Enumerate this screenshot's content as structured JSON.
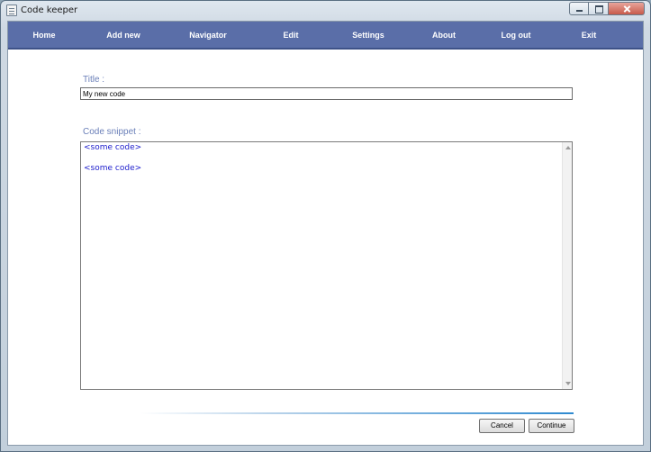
{
  "window": {
    "title": "Code keeper",
    "controls": [
      "minimize-icon",
      "maximize-icon",
      "close-icon"
    ]
  },
  "menu": {
    "items": [
      {
        "label": "Home"
      },
      {
        "label": "Add new"
      },
      {
        "label": "Navigator"
      },
      {
        "label": "Edit"
      },
      {
        "label": "Settings"
      },
      {
        "label": "About"
      },
      {
        "label": "Log out"
      },
      {
        "label": "Exit"
      }
    ]
  },
  "form": {
    "title_label": "Title :",
    "title_value": "My new code",
    "snippet_label": "Code snippet :",
    "snippet_lines": [
      "<some code>",
      "",
      "<some code>"
    ]
  },
  "buttons": {
    "cancel": "Cancel",
    "continue": "Continue"
  },
  "colors": {
    "menubar": "#5a6ea8",
    "label": "#6a7fb8",
    "code_text": "#1a1acc"
  }
}
